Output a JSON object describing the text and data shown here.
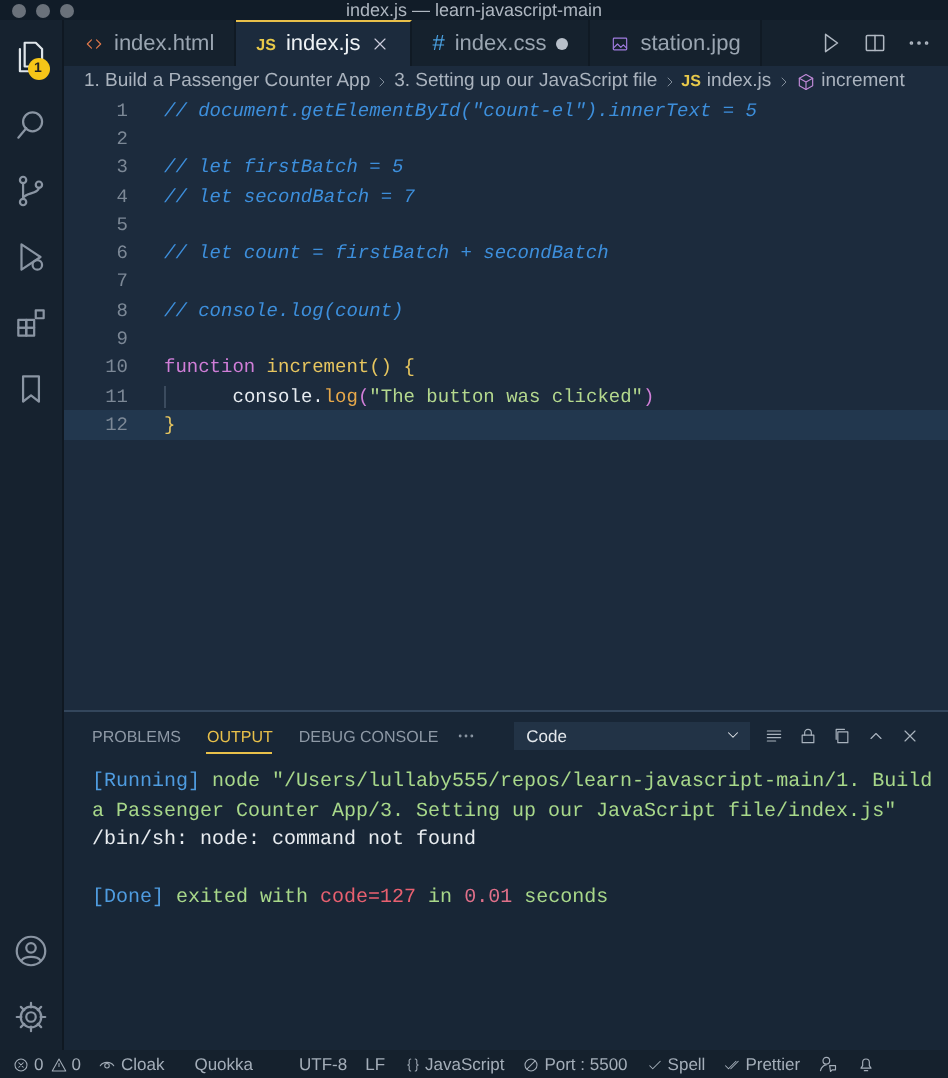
{
  "window": {
    "title": "index.js — learn-javascript-main"
  },
  "activity_bar": {
    "items": [
      {
        "kind": "files",
        "badge": "1"
      },
      {
        "kind": "search"
      },
      {
        "kind": "source-control"
      },
      {
        "kind": "run"
      },
      {
        "kind": "extensions"
      },
      {
        "kind": "bookmark"
      }
    ],
    "bottom": [
      {
        "kind": "account"
      },
      {
        "kind": "settings"
      }
    ]
  },
  "tabs": [
    {
      "label": "index.html",
      "kind": "html",
      "selected": false,
      "modified": false
    },
    {
      "label": "index.js",
      "kind": "js",
      "icon_label": "JS",
      "selected": true,
      "modified": false
    },
    {
      "label": "index.css",
      "kind": "css",
      "icon_label": "#",
      "selected": false,
      "modified": true
    },
    {
      "label": "station.jpg",
      "kind": "image",
      "selected": false,
      "modified": false
    }
  ],
  "breadcrumb": [
    {
      "label": "1. Build a Passenger Counter App",
      "kind": "folder"
    },
    {
      "label": "3. Setting up our JavaScript file",
      "kind": "folder"
    },
    {
      "label": "index.js",
      "kind": "js",
      "icon_label": "JS"
    },
    {
      "label": "increment",
      "kind": "symbol"
    }
  ],
  "editor": {
    "lines": [
      {
        "number": "1",
        "current": false,
        "tokens": [
          {
            "kind": "comment",
            "text": "// document.getElementById(\"count-el\").innerText = 5"
          }
        ]
      },
      {
        "number": "2",
        "current": false
      },
      {
        "number": "3",
        "current": false,
        "tokens": [
          {
            "kind": "comment",
            "text": "// let firstBatch = 5"
          }
        ]
      },
      {
        "number": "4",
        "current": false,
        "tokens": [
          {
            "kind": "comment",
            "text": "// let secondBatch = 7"
          }
        ]
      },
      {
        "number": "5",
        "current": false
      },
      {
        "number": "6",
        "current": false,
        "tokens": [
          {
            "kind": "comment",
            "text": "// let count = firstBatch + secondBatch"
          }
        ]
      },
      {
        "number": "7",
        "current": false
      },
      {
        "number": "8",
        "current": false,
        "tokens": [
          {
            "kind": "comment",
            "text": "// console.log(count)"
          }
        ]
      },
      {
        "number": "9",
        "current": false
      },
      {
        "number": "10",
        "current": false,
        "tokens": [
          {
            "kind": "keyword",
            "text": "function"
          },
          {
            "kind": "function",
            "text": "increment"
          },
          {
            "kind": "paren",
            "text": "() {"
          }
        ]
      },
      {
        "number": "11",
        "current": false,
        "indented": true,
        "tokens": [
          {
            "kind": "plain",
            "text": "console."
          },
          {
            "kind": "method",
            "text": "log"
          },
          {
            "kind": "paren2",
            "text": "("
          },
          {
            "kind": "string",
            "text": "\"The button was clicked\""
          },
          {
            "kind": "paren2",
            "text": ")"
          }
        ]
      },
      {
        "number": "12",
        "current": true,
        "tokens": [
          {
            "kind": "paren",
            "text": "}"
          }
        ]
      }
    ]
  },
  "panel": {
    "tabs": [
      {
        "label": "PROBLEMS",
        "selected": false
      },
      {
        "label": "OUTPUT",
        "selected": true
      },
      {
        "label": "DEBUG CONSOLE",
        "selected": false
      }
    ],
    "dropdown": "Code",
    "output": [
      {
        "blank_before": false,
        "tokens": [
          {
            "kind": "tag",
            "text": "[Running]"
          },
          {
            "kind": "path",
            "text": " node \"/Users/lullaby555/repos/learn-javascript-main/1. Build"
          }
        ]
      },
      {
        "blank_before": false,
        "tokens": [
          {
            "kind": "path",
            "text": "a Passenger Counter App/3. Setting up our JavaScript file/index.js\""
          }
        ]
      },
      {
        "blank_before": false,
        "tokens": [
          {
            "kind": "plain",
            "text": "/bin/sh: node: command not found"
          }
        ]
      },
      {
        "blank_before": true,
        "tokens": [
          {
            "kind": "tag",
            "text": "[Done]"
          },
          {
            "kind": "path",
            "text": " exited with "
          },
          {
            "kind": "error",
            "text": "code=127"
          },
          {
            "kind": "path",
            "text": " in "
          },
          {
            "kind": "number",
            "text": "0.01"
          },
          {
            "kind": "path",
            "text": " seconds"
          }
        ]
      }
    ]
  },
  "status_bar": [
    {
      "kind": "errors",
      "text": "0"
    },
    {
      "kind": "warnings",
      "text": "0"
    },
    {
      "kind": "cloak",
      "text": "Cloak"
    },
    {
      "kind": "plain",
      "text": "Quokka"
    },
    {
      "kind": "plain",
      "text": "UTF-8"
    },
    {
      "kind": "plain",
      "text": "LF"
    },
    {
      "kind": "language",
      "text": "JavaScript"
    },
    {
      "kind": "port",
      "text": "Port : 5500"
    },
    {
      "kind": "spell",
      "text": "Spell"
    },
    {
      "kind": "prettier",
      "text": "Prettier"
    },
    {
      "kind": "feedback"
    },
    {
      "kind": "bell"
    }
  ]
}
